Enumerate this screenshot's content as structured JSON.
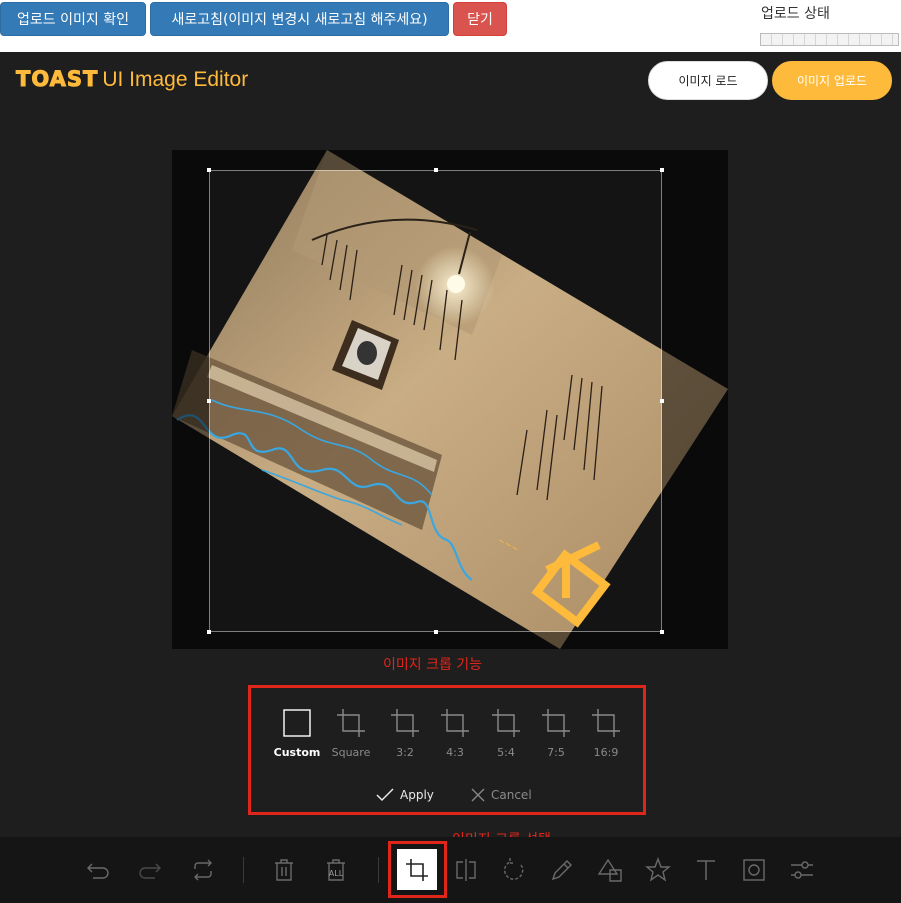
{
  "topbar": {
    "confirm_label": "업로드 이미지 확인",
    "refresh_label": "새로고침(이미지 변경시 새로고침 해주세요)",
    "close_label": "닫기",
    "status_label": "업로드 상태"
  },
  "editor": {
    "logo_bold": "TOAST",
    "logo_rest": "UI Image Editor",
    "load_label": "이미지 로드",
    "upload_label": "이미지 업로드"
  },
  "annotations": {
    "crop_feature": "이미지 크롭 기능",
    "crop_select": "이미지 크롭 선택"
  },
  "crop_menu": {
    "presets": [
      {
        "label": "Custom",
        "icon": "square-icon"
      },
      {
        "label": "Square",
        "icon": "crop-icon"
      },
      {
        "label": "3:2",
        "icon": "crop-icon"
      },
      {
        "label": "4:3",
        "icon": "crop-icon"
      },
      {
        "label": "5:4",
        "icon": "crop-icon"
      },
      {
        "label": "7:5",
        "icon": "crop-icon"
      },
      {
        "label": "16:9",
        "icon": "crop-icon"
      }
    ],
    "active_preset": "Custom",
    "apply_label": "Apply",
    "cancel_label": "Cancel"
  },
  "toolbar": {
    "tools": [
      "undo-icon",
      "redo-icon",
      "reset-icon",
      "delete-icon",
      "delete-all-icon",
      "crop-icon",
      "flip-icon",
      "rotate-icon",
      "draw-icon",
      "shape-icon",
      "icon-icon",
      "text-icon",
      "mask-icon",
      "filter-icon"
    ],
    "active_tool": "crop-icon",
    "delete_all_text": "ALL"
  },
  "colors": {
    "accent": "#fdba3b",
    "annotation": "#e0261b",
    "primary_button": "#337ab7",
    "danger_button": "#d9534f",
    "editor_bg": "#1e1e1e"
  }
}
